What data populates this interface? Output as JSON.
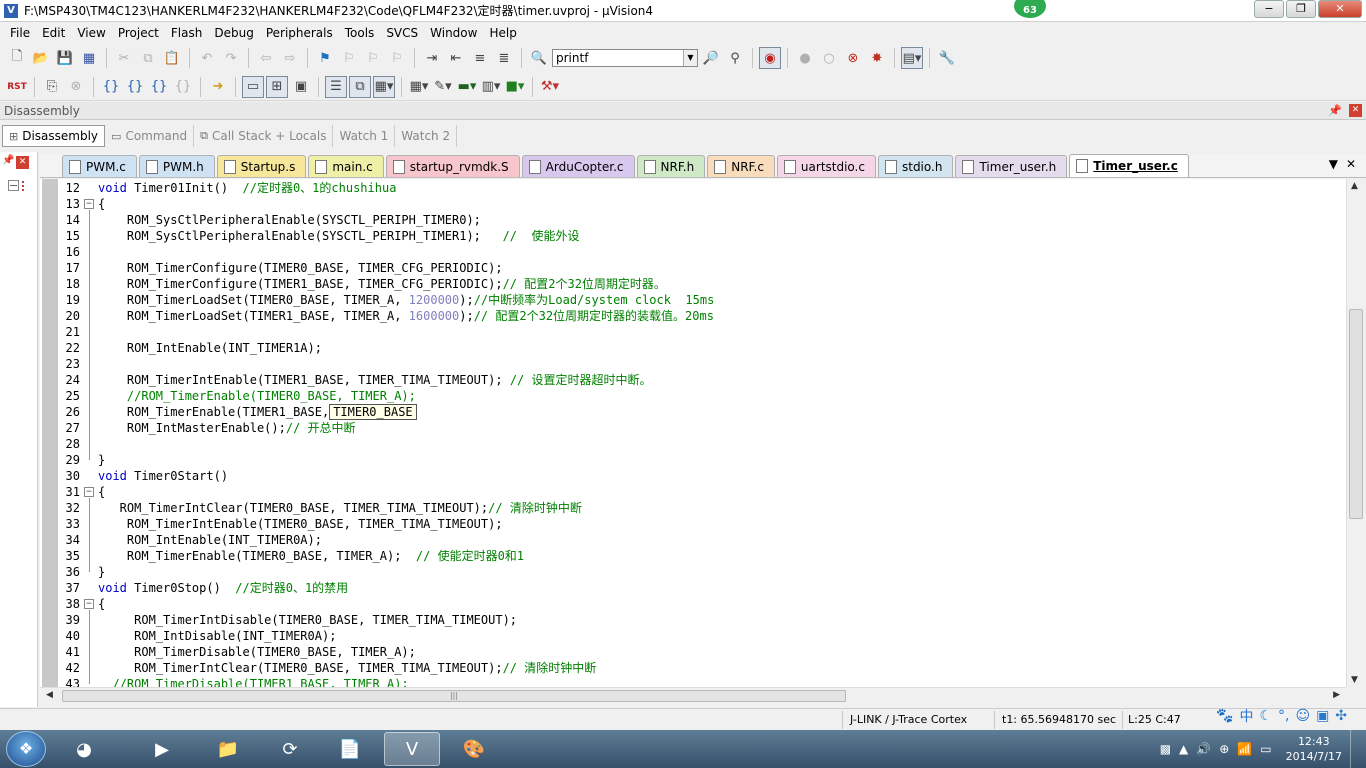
{
  "window": {
    "title": "F:\\MSP430\\TM4C123\\HANKERLM4F232\\HANKERLM4F232\\Code\\QFLM4F232\\定时器\\timer.uvproj - µVision4",
    "badge": "63",
    "minimize": "−",
    "maximize": "❐",
    "close": "✕"
  },
  "menu": [
    "File",
    "Edit",
    "View",
    "Project",
    "Flash",
    "Debug",
    "Peripherals",
    "Tools",
    "SVCS",
    "Window",
    "Help"
  ],
  "toolbar": {
    "find_value": "printf",
    "new_icon": "new-file-icon",
    "open_icon": "open-folder-icon",
    "save_icon": "save-icon",
    "rst_label": "RST"
  },
  "disassembly_header": "Disassembly",
  "window_tabs": [
    {
      "label": "Disassembly",
      "active": true
    },
    {
      "label": "Command",
      "active": false
    },
    {
      "label": "Call Stack + Locals",
      "active": false
    },
    {
      "label": "Watch 1",
      "active": false
    },
    {
      "label": "Watch 2",
      "active": false
    }
  ],
  "file_tabs": [
    {
      "label": "PWM.c",
      "color": "#cfe2f4",
      "active": false
    },
    {
      "label": "PWM.h",
      "color": "#cfe2f4",
      "active": false
    },
    {
      "label": "Startup.s",
      "color": "#f7e79a",
      "active": false
    },
    {
      "label": "main.c",
      "color": "#eef0a8",
      "active": false
    },
    {
      "label": "startup_rvmdk.S",
      "color": "#f7c6cc",
      "active": false
    },
    {
      "label": "ArduCopter.c",
      "color": "#d8c8ee",
      "active": false
    },
    {
      "label": "NRF.h",
      "color": "#cfe8c6",
      "active": false
    },
    {
      "label": "NRF.c",
      "color": "#f9dcbc",
      "active": false
    },
    {
      "label": "uartstdio.c",
      "color": "#f4d6e8",
      "active": false
    },
    {
      "label": "stdio.h",
      "color": "#d2e4f0",
      "active": false
    },
    {
      "label": "Timer_user.h",
      "color": "#e4dcec",
      "active": false
    },
    {
      "label": "Timer_user.c",
      "color": "#ffffff",
      "active": true
    }
  ],
  "code_lines": [
    {
      "n": "12",
      "parts": [
        {
          "t": "void",
          "c": "kw"
        },
        {
          "t": " Timer01Init()  "
        },
        {
          "t": "//定时器0、1的chushihua",
          "c": "cm"
        }
      ]
    },
    {
      "n": "13",
      "fold": "−",
      "parts": [
        {
          "t": "{"
        }
      ]
    },
    {
      "n": "14",
      "parts": [
        {
          "t": "    ROM_SysCtlPeripheralEnable(SYSCTL_PERIPH_TIMER0);"
        }
      ]
    },
    {
      "n": "15",
      "parts": [
        {
          "t": "    ROM_SysCtlPeripheralEnable(SYSCTL_PERIPH_TIMER1);   "
        },
        {
          "t": "//  使能外设",
          "c": "cm"
        }
      ]
    },
    {
      "n": "16",
      "parts": []
    },
    {
      "n": "17",
      "parts": [
        {
          "t": "    ROM_TimerConfigure(TIMER0_BASE, TIMER_CFG_PERIODIC);"
        }
      ]
    },
    {
      "n": "18",
      "parts": [
        {
          "t": "    ROM_TimerConfigure(TIMER1_BASE, TIMER_CFG_PERIODIC);"
        },
        {
          "t": "// 配置2个32位周期定时器。",
          "c": "cm"
        }
      ]
    },
    {
      "n": "19",
      "parts": [
        {
          "t": "    ROM_TimerLoadSet(TIMER0_BASE, TIMER_A, "
        },
        {
          "t": "1200000",
          "c": "num"
        },
        {
          "t": ");"
        },
        {
          "t": "//中断频率为Load/system clock  15ms",
          "c": "cm"
        }
      ]
    },
    {
      "n": "20",
      "parts": [
        {
          "t": "    ROM_TimerLoadSet(TIMER1_BASE, TIMER_A, "
        },
        {
          "t": "1600000",
          "c": "num"
        },
        {
          "t": ");"
        },
        {
          "t": "// 配置2个32位周期定时器的装载值。20ms",
          "c": "cm"
        }
      ]
    },
    {
      "n": "21",
      "parts": []
    },
    {
      "n": "22",
      "parts": [
        {
          "t": "    ROM_IntEnable(INT_TIMER1A);"
        }
      ]
    },
    {
      "n": "23",
      "parts": []
    },
    {
      "n": "24",
      "parts": [
        {
          "t": "    ROM_TimerIntEnable(TIMER1_BASE, TIMER_TIMA_TIMEOUT); "
        },
        {
          "t": "// 设置定时器超时中断。",
          "c": "cm"
        }
      ]
    },
    {
      "n": "25",
      "parts": [
        {
          "t": "    //ROM_TimerEnable(TIMER0_BASE, TIMER_A);",
          "c": "cm"
        }
      ]
    },
    {
      "n": "26",
      "parts": [
        {
          "t": "    ROM_TimerEnable(TIMER1_BASE,"
        },
        {
          "t": "TIMER0_BASE",
          "c": "tip"
        }
      ]
    },
    {
      "n": "27",
      "parts": [
        {
          "t": "    ROM_IntMasterEnable();"
        },
        {
          "t": "// 开总中断",
          "c": "cm"
        }
      ]
    },
    {
      "n": "28",
      "parts": []
    },
    {
      "n": "29",
      "parts": [
        {
          "t": "}"
        }
      ]
    },
    {
      "n": "30",
      "parts": [
        {
          "t": "void",
          "c": "kw"
        },
        {
          "t": " Timer0Start()"
        }
      ]
    },
    {
      "n": "31",
      "fold": "−",
      "parts": [
        {
          "t": "{"
        }
      ]
    },
    {
      "n": "32",
      "parts": [
        {
          "t": "   ROM_TimerIntClear(TIMER0_BASE, TIMER_TIMA_TIMEOUT);"
        },
        {
          "t": "// 清除时钟中断",
          "c": "cm"
        }
      ]
    },
    {
      "n": "33",
      "parts": [
        {
          "t": "    ROM_TimerIntEnable(TIMER0_BASE, TIMER_TIMA_TIMEOUT);"
        }
      ]
    },
    {
      "n": "34",
      "parts": [
        {
          "t": "    ROM_IntEnable(INT_TIMER0A);"
        }
      ]
    },
    {
      "n": "35",
      "parts": [
        {
          "t": "    ROM_TimerEnable(TIMER0_BASE, TIMER_A);  "
        },
        {
          "t": "// 使能定时器0和1",
          "c": "cm"
        }
      ]
    },
    {
      "n": "36",
      "parts": [
        {
          "t": "}"
        }
      ]
    },
    {
      "n": "37",
      "parts": [
        {
          "t": "void",
          "c": "kw"
        },
        {
          "t": " Timer0Stop()  "
        },
        {
          "t": "//定时器0、1的禁用",
          "c": "cm"
        }
      ]
    },
    {
      "n": "38",
      "fold": "−",
      "parts": [
        {
          "t": "{"
        }
      ]
    },
    {
      "n": "39",
      "parts": [
        {
          "t": "     ROM_TimerIntDisable(TIMER0_BASE, TIMER_TIMA_TIMEOUT);"
        }
      ]
    },
    {
      "n": "40",
      "parts": [
        {
          "t": "     ROM_IntDisable(INT_TIMER0A);"
        }
      ]
    },
    {
      "n": "41",
      "parts": [
        {
          "t": "     ROM_TimerDisable(TIMER0_BASE, TIMER_A);"
        }
      ]
    },
    {
      "n": "42",
      "parts": [
        {
          "t": "     ROM_TimerIntClear(TIMER0_BASE, TIMER_TIMA_TIMEOUT);"
        },
        {
          "t": "// 清除时钟中断",
          "c": "cm"
        }
      ]
    },
    {
      "n": "43",
      "parts": [
        {
          "t": "  //ROM_TimerDisable(TIMER1_BASE, TIMER_A);",
          "c": "cm"
        }
      ]
    }
  ],
  "status": {
    "debugger": "J-LINK / J-Trace Cortex",
    "time": "t1: 65.56948170 sec",
    "position": "L:25 C:47"
  },
  "ime": {
    "lang": "中"
  },
  "taskbar": {
    "start_glyph": "❖",
    "time": "12:43",
    "date": "2014/7/17",
    "apps": [
      "chrome-like-icon",
      "media-player-icon",
      "file-explorer-icon",
      "sync-icon",
      "pdf-icon",
      "keil-uvision-icon",
      "paint-icon"
    ]
  }
}
